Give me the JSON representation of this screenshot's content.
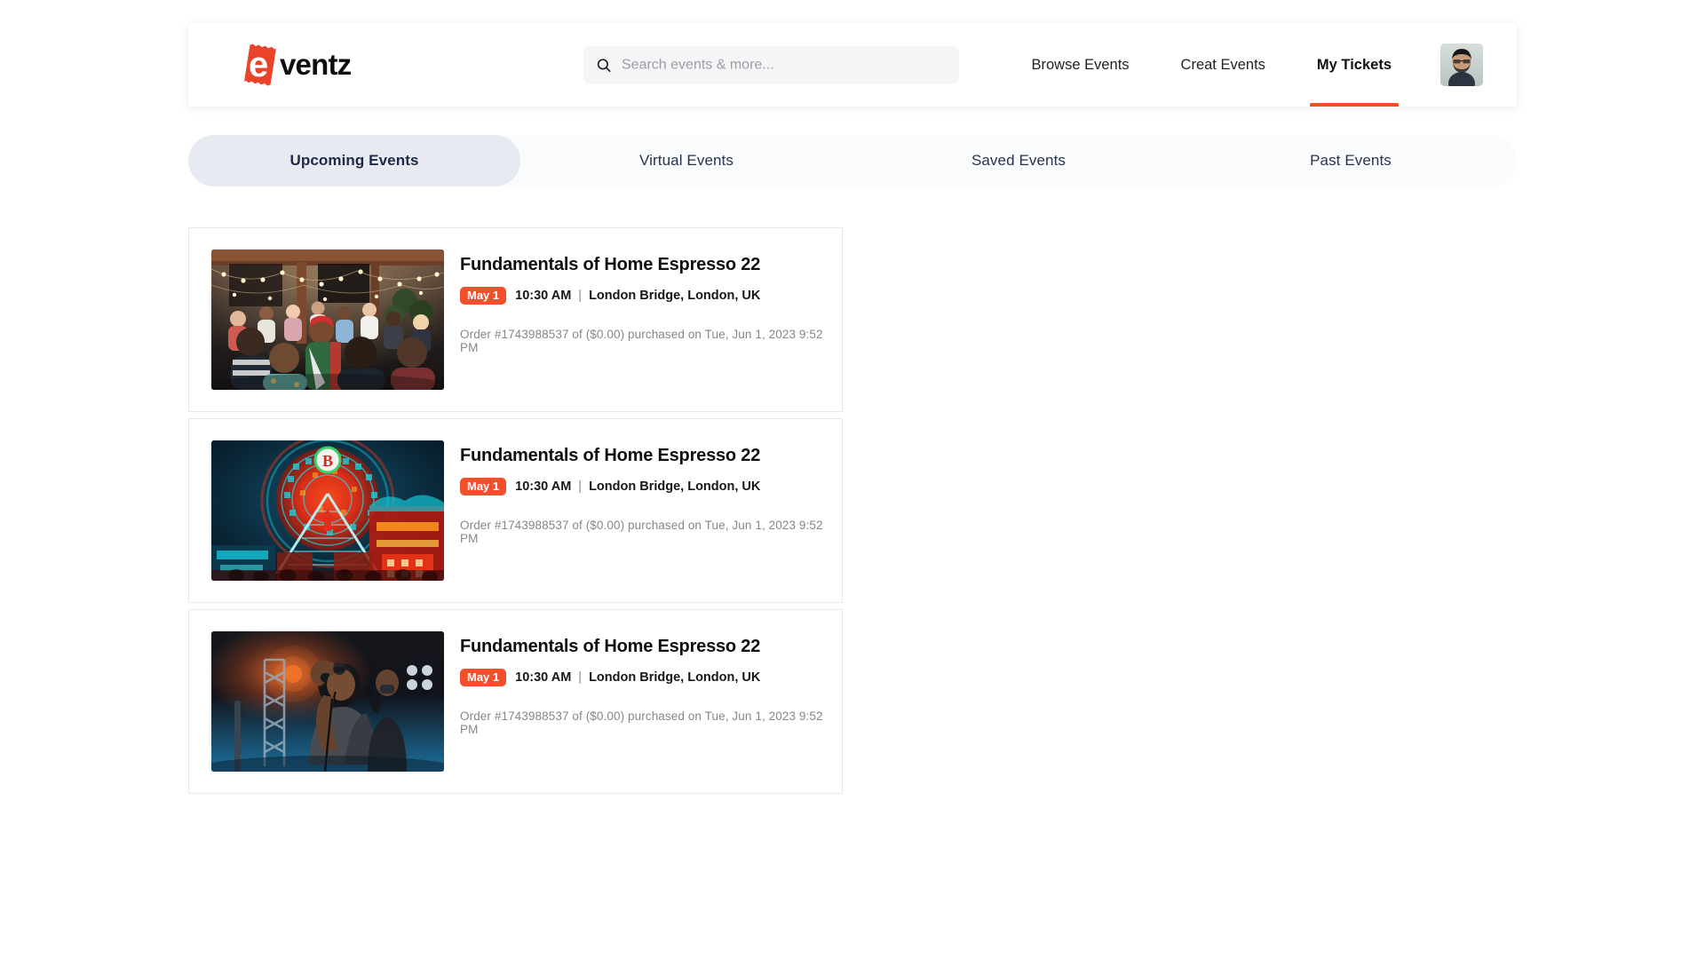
{
  "header": {
    "logo": {
      "mark_letter": "e",
      "text": "ventz",
      "accent_color": "#E9432A"
    },
    "search": {
      "value": "",
      "placeholder": "Search events & more...",
      "icon": "search-icon"
    },
    "nav": [
      {
        "label": "Browse Events",
        "active": false
      },
      {
        "label": "Creat Events",
        "active": false
      },
      {
        "label": "My Tickets",
        "active": true
      }
    ],
    "avatar": {
      "icon": "avatar",
      "alt": "User profile photo"
    },
    "active_accent_color": "#F04E23"
  },
  "tabs": [
    {
      "label": "Upcoming Events",
      "active": true
    },
    {
      "label": "Virtual Events",
      "active": false
    },
    {
      "label": "Saved Events",
      "active": false
    },
    {
      "label": "Past Events",
      "active": false
    }
  ],
  "events": [
    {
      "title": "Fundamentals of Home Espresso 22",
      "date_badge": "May 1",
      "time": "10:30 AM",
      "separator": "|",
      "location": "London Bridge, London, UK",
      "order": "Order #1743988537 of ($0.00) purchased on Tue, Jun 1, 2023 9:52 PM",
      "image": "crowd-party-string-lights"
    },
    {
      "title": "Fundamentals of Home Espresso 22",
      "date_badge": "May 1",
      "time": "10:30 AM",
      "separator": "|",
      "location": "London Bridge, London, UK",
      "order": "Order #1743988537 of ($0.00) purchased on Tue, Jun 1, 2023 9:52 PM",
      "image": "neon-ferris-wheel-fairground"
    },
    {
      "title": "Fundamentals of Home Espresso 22",
      "date_badge": "May 1",
      "time": "10:30 AM",
      "separator": "|",
      "location": "London Bridge, London, UK",
      "order": "Order #1743988537 of ($0.00) purchased on Tue, Jun 1, 2023 9:52 PM",
      "image": "concert-singer-stage-lights"
    }
  ],
  "colors": {
    "brand_orange": "#F04E23",
    "badge_red": "#F2502C",
    "tab_active_bg": "#E7EAF0",
    "tab_text": "#27334E"
  }
}
